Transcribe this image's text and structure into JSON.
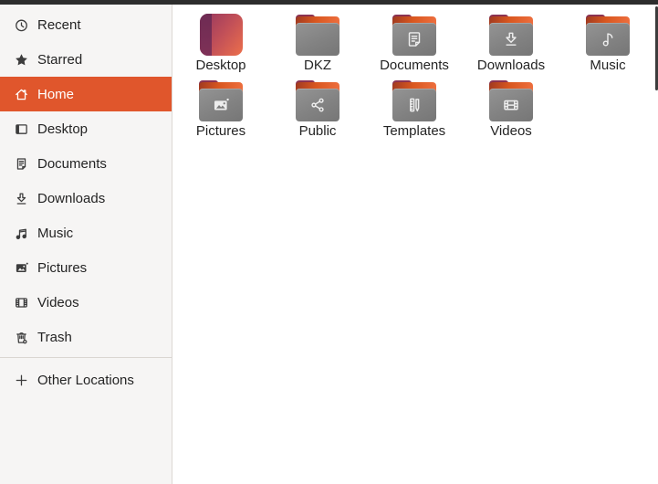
{
  "window": {
    "app": "file-browser",
    "topbar_color": "#2d2d2d"
  },
  "sidebar": {
    "selected_bg": "#e0562c",
    "items": [
      {
        "label": "Recent",
        "icon": "recent-icon",
        "selected": false
      },
      {
        "label": "Starred",
        "icon": "star-icon",
        "selected": false
      },
      {
        "label": "Home",
        "icon": "home-icon",
        "selected": true
      },
      {
        "label": "Desktop",
        "icon": "desktop-icon",
        "selected": false
      },
      {
        "label": "Documents",
        "icon": "documents-icon",
        "selected": false
      },
      {
        "label": "Downloads",
        "icon": "downloads-icon",
        "selected": false
      },
      {
        "label": "Music",
        "icon": "music-icon",
        "selected": false
      },
      {
        "label": "Pictures",
        "icon": "pictures-icon",
        "selected": false
      },
      {
        "label": "Videos",
        "icon": "videos-icon",
        "selected": false
      },
      {
        "label": "Trash",
        "icon": "trash-icon",
        "selected": false
      }
    ],
    "footer_item": {
      "label": "Other Locations",
      "icon": "plus-icon"
    }
  },
  "files": {
    "folder_colors": {
      "body": "#838383",
      "tab_orange": "#e2602f",
      "tab_plum": "#7d2c46"
    },
    "items": [
      {
        "label": "Desktop",
        "kind": "desktop-gradient",
        "emblem": "none"
      },
      {
        "label": "DKZ",
        "kind": "folder",
        "emblem": "none"
      },
      {
        "label": "Documents",
        "kind": "folder",
        "emblem": "document-emblem"
      },
      {
        "label": "Downloads",
        "kind": "folder",
        "emblem": "download-emblem"
      },
      {
        "label": "Music",
        "kind": "folder",
        "emblem": "music-emblem"
      },
      {
        "label": "Pictures",
        "kind": "folder",
        "emblem": "picture-emblem"
      },
      {
        "label": "Public",
        "kind": "folder",
        "emblem": "share-emblem"
      },
      {
        "label": "Templates",
        "kind": "folder",
        "emblem": "template-emblem"
      },
      {
        "label": "Videos",
        "kind": "folder",
        "emblem": "film-emblem"
      }
    ]
  }
}
